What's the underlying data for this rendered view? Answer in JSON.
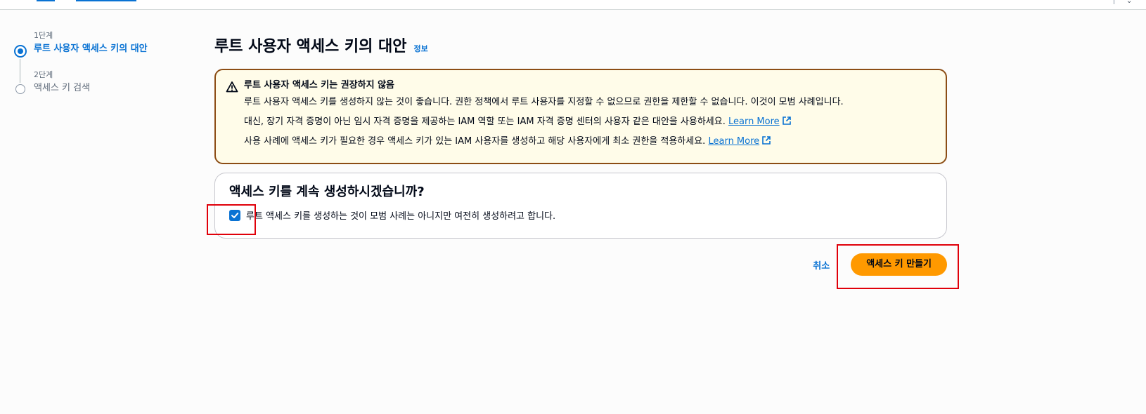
{
  "steps": [
    {
      "number": "1단계",
      "title": "루트 사용자 액세스 키의 대안",
      "state": "active"
    },
    {
      "number": "2단계",
      "title": "액세스 키 검색",
      "state": "inactive"
    }
  ],
  "page": {
    "title": "루트 사용자 액세스 키의 대안",
    "info_link": "정보"
  },
  "warning": {
    "title": "루트 사용자 액세스 키는 권장하지 않음",
    "line1": "루트 사용자 액세스 키를 생성하지 않는 것이 좋습니다. 권한 정책에서 루트 사용자를 지정할 수 없으므로 권한을 제한할 수 없습니다. 이것이 모범 사례입니다.",
    "line2": "대신, 장기 자격 증명이 아닌 임시 자격 증명을 제공하는 IAM 역할 또는 IAM 자격 증명 센터의 사용자 같은 대안을 사용하세요.",
    "line3": "사용 사례에 액세스 키가 필요한 경우 액세스 키가 있는 IAM 사용자를 생성하고 해당 사용자에게 최소 권한을 적용하세요.",
    "learn_more": "Learn More"
  },
  "confirm": {
    "title": "액세스 키를 계속 생성하시겠습니까?",
    "checkbox_label": "루트 액세스 키를 생성하는 것이 모범 사례는 아니지만 여전히 생성하려고 합니다.",
    "checked": true
  },
  "actions": {
    "cancel": "취소",
    "create": "액세스 키 만들기"
  },
  "colors": {
    "accent": "#0972d3",
    "primary_button": "#ff9900",
    "warning_border": "#8c4d15",
    "warning_bg": "#fffce9",
    "highlight": "#e0000a"
  }
}
